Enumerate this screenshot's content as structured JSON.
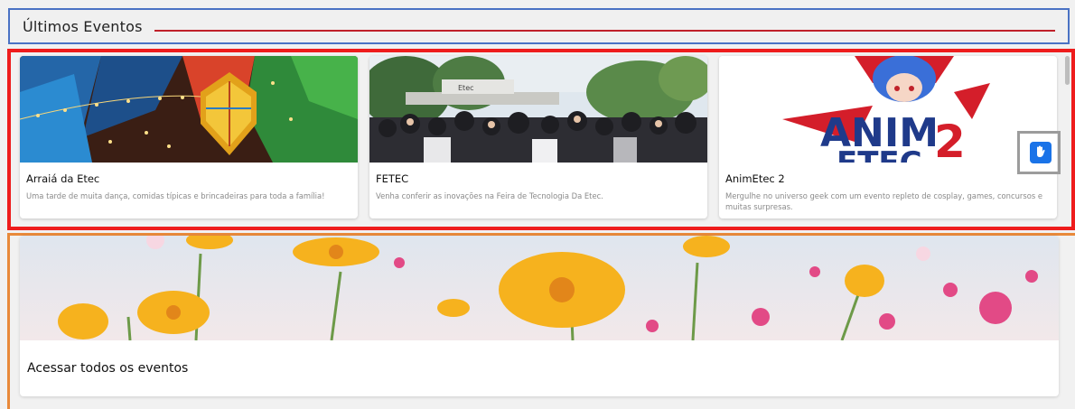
{
  "header": {
    "title": "Últimos Eventos"
  },
  "events": [
    {
      "title": "Arraiá da Etec",
      "description": "Uma tarde de muita dança, comidas típicas e brincadeiras para toda a família!"
    },
    {
      "title": "FETEC",
      "description": "Venha conferir as inovações na Feira de Tecnologia Da Etec.",
      "image_sign": "Etec"
    },
    {
      "title": "AnimEtec 2",
      "description": "Mergulhe no universo geek com um evento repleto de cosplay, games, concursos e muitas surpresas.",
      "logo_text": "ANIM",
      "logo_number": "2",
      "logo_sub": "ETEC"
    }
  ],
  "all_events": {
    "title": "Acessar todos os eventos"
  },
  "icons": {
    "accessibility": "hand-sign-language-icon"
  },
  "colors": {
    "header_outline": "#4a72c4",
    "header_line": "#c0212a",
    "events_outline": "#ee1c1c",
    "all_events_outline": "#e8893a",
    "accessibility_button": "#1a73e8"
  }
}
